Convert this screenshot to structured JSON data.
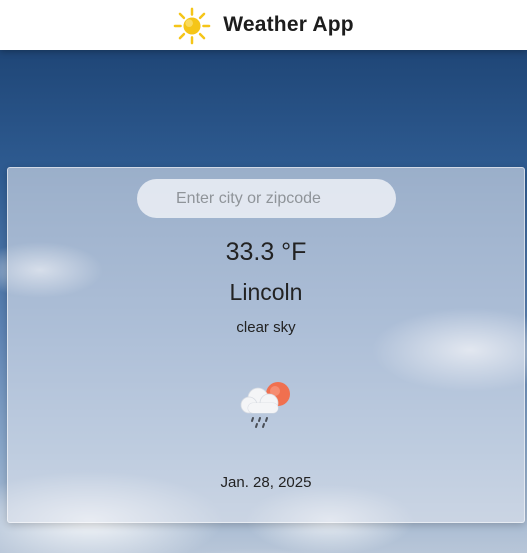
{
  "header": {
    "logo_icon": "sun-icon",
    "title": "Weather App"
  },
  "search": {
    "value": "",
    "placeholder": "Enter city or zipcode"
  },
  "weather": {
    "temperature": "33.3 °F",
    "city": "Lincoln",
    "description": "clear sky",
    "icon": "cloud-rain-sun-icon",
    "date": "Jan. 28, 2025"
  },
  "colors": {
    "sun": "#f5c518",
    "sun_badge": "#f0704f",
    "header_bg": "#ffffff",
    "text": "#222222"
  }
}
